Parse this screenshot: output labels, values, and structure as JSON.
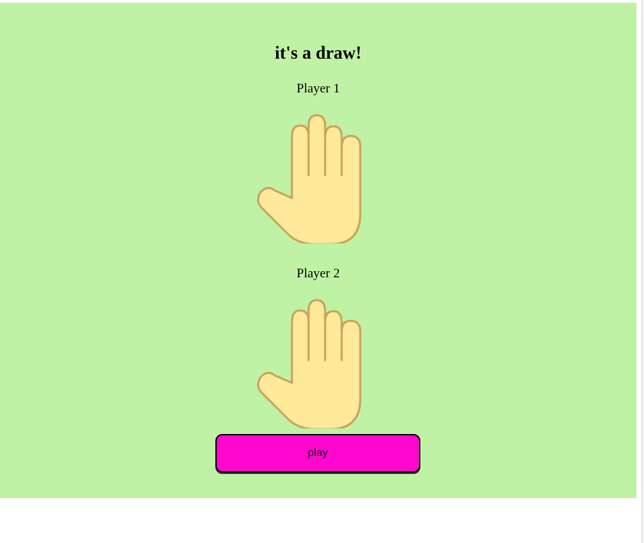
{
  "result": {
    "title": "it's a draw!"
  },
  "players": [
    {
      "label": "Player 1",
      "choice": "paper",
      "icon": "raised-hand-icon"
    },
    {
      "label": "Player 2",
      "choice": "paper",
      "icon": "raised-hand-icon"
    }
  ],
  "controls": {
    "play_label": "play"
  },
  "colors": {
    "background": "#c0f2a5",
    "button": "#fe08cf",
    "hand_fill": "#ffe99b",
    "hand_stroke": "#c9a45a"
  }
}
